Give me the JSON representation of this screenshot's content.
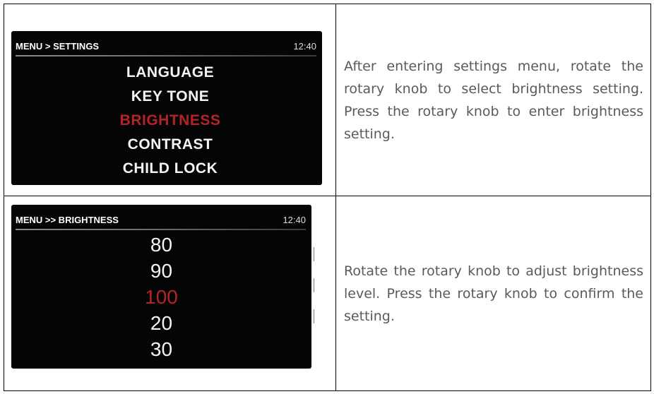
{
  "steps": [
    {
      "screen": {
        "breadcrumb": "MENU > SETTINGS",
        "clock": "12:40",
        "items": [
          {
            "label": "LANGUAGE",
            "selected": false
          },
          {
            "label": "KEY TONE",
            "selected": false
          },
          {
            "label": "BRIGHTNESS",
            "selected": true
          },
          {
            "label": "CONTRAST",
            "selected": false
          },
          {
            "label": "CHILD LOCK",
            "selected": false
          }
        ]
      },
      "description": "After entering settings menu, rotate the rotary knob to select brightness setting. Press the rotary knob to enter brightness setting."
    },
    {
      "screen": {
        "breadcrumb": "MENU >> BRIGHTNESS",
        "clock": "12:40",
        "items": [
          {
            "label": "80",
            "selected": false
          },
          {
            "label": "90",
            "selected": false
          },
          {
            "label": "100",
            "selected": true
          },
          {
            "label": "20",
            "selected": false
          },
          {
            "label": "30",
            "selected": false
          }
        ]
      },
      "description": "Rotate the rotary knob to adjust brightness level. Press the rotary knob to confirm the setting."
    }
  ],
  "colors": {
    "screen_background": "#050505",
    "screen_text": "#f4f4f4",
    "selected_item": "#b52424",
    "description_text": "#5a5a5a",
    "table_border": "#000000"
  }
}
